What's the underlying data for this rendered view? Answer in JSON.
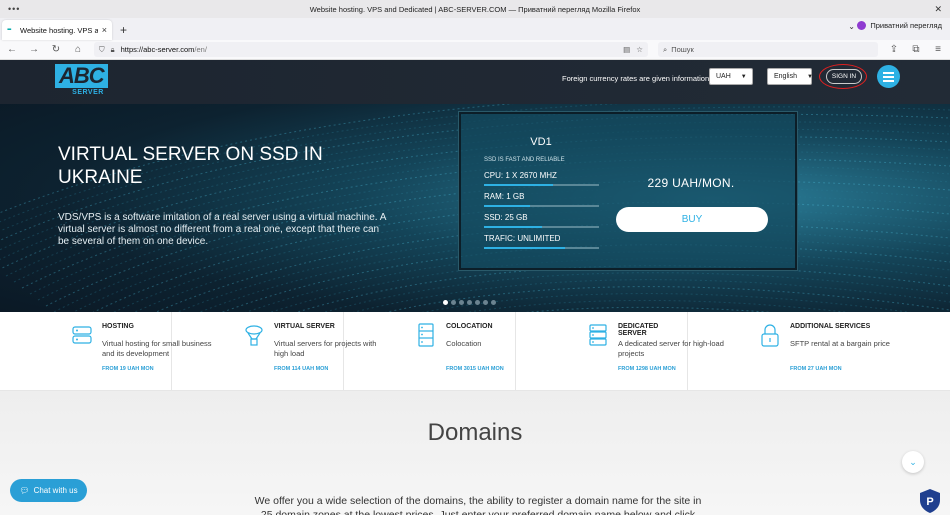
{
  "window": {
    "title": "Website hosting. VPS and Dedicated | ABC-SERVER.COM — Приватний перегляд Mozilla Firefox"
  },
  "browser": {
    "tab_title": "Website hosting. VPS and D",
    "private_label": "Приватний перегляд",
    "url_host": "https://abc-server.com",
    "url_path": "/en/",
    "search_placeholder": "Пошук"
  },
  "header": {
    "logo_text": "ABC",
    "logo_sub": "SERVER",
    "currency_note": "Foreign currency rates are given information",
    "currency_value": "UAH",
    "language_value": "English",
    "signin_label": "SIGN IN"
  },
  "hero": {
    "title": "VIRTUAL SERVER ON SSD IN UKRAINE",
    "description": "VDS/VPS is a software imitation of a real server using a virtual machine. A virtual server is almost no different from a real one, except that there can be several of them on one device.",
    "plan": {
      "name": "VD1",
      "subtitle": "SSD IS FAST AND RELIABLE",
      "specs": [
        {
          "label": "CPU: 1 X 2670 MHZ",
          "level": 0.6
        },
        {
          "label": "RAM: 1 GB",
          "level": 0.4
        },
        {
          "label": "SSD: 25 GB",
          "level": 0.5
        },
        {
          "label": "TRAFIC: UNLIMITED",
          "level": 0.7
        }
      ],
      "price": "229 UAH/MON.",
      "buy_label": "BUY"
    },
    "slides_count": 7,
    "active_slide": 0
  },
  "services": [
    {
      "name": "HOSTING",
      "desc": "Virtual hosting for small business and its development",
      "price": "FROM 19 UAH MON",
      "icon": "hosting-icon"
    },
    {
      "name": "VIRTUAL SERVER",
      "desc": "Virtual servers for projects with high load",
      "price": "FROM 114 UAH MON",
      "icon": "virtual-server-icon"
    },
    {
      "name": "COLOCATION",
      "desc": "Colocation",
      "price": "FROM 3015 UAH MON",
      "icon": "colocation-icon"
    },
    {
      "name": "DEDICATED SERVER",
      "desc": "A dedicated server for high-load projects",
      "price": "FROM 1298 UAH MON",
      "icon": "dedicated-server-icon"
    },
    {
      "name": "ADDITIONAL SERVICES",
      "desc": "SFTP rental at a bargain price",
      "price": "FROM 27 UAH MON",
      "icon": "lock-icon"
    }
  ],
  "domains": {
    "title": "Domains",
    "text": "We offer you a wide selection of the domains, the ability to register a domain name for the site in 25 domain zones at the lowest prices. Just enter your preferred domain name below and click \"Check your"
  },
  "chat": {
    "label": "Chat with us"
  },
  "colors": {
    "accent": "#2eb1e4",
    "header_bg": "#1d2530",
    "price_blue": "#2a9fd6"
  }
}
